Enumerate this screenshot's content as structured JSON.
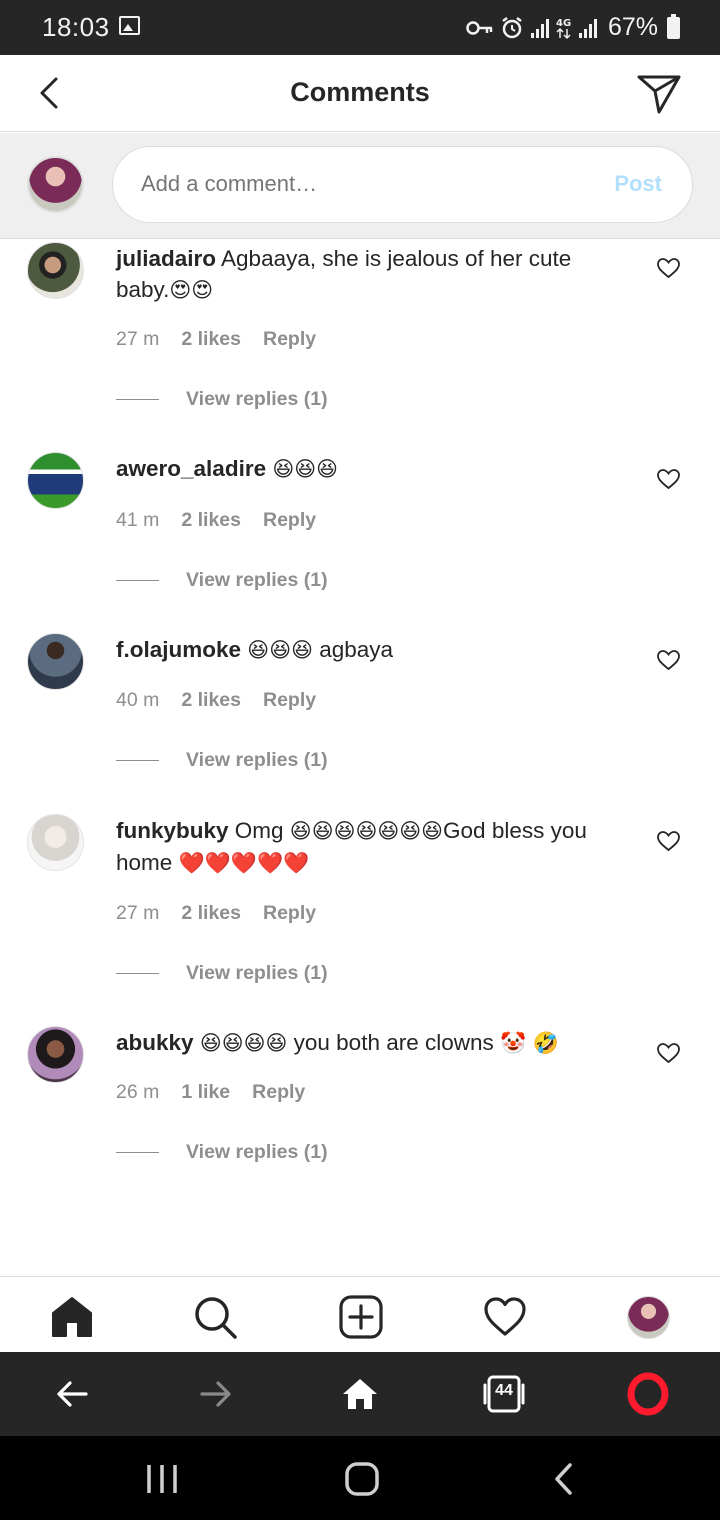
{
  "status_bar": {
    "time": "18:03",
    "battery_percent": "67%",
    "network_type": "4G",
    "icons": [
      "image-icon",
      "key-icon",
      "alarm-icon",
      "signal-icon",
      "signal-icon",
      "battery-icon"
    ]
  },
  "header": {
    "title": "Comments",
    "back_icon": "chevron-left-icon",
    "send_icon": "paper-plane-icon"
  },
  "composer": {
    "placeholder": "Add a comment…",
    "post_label": "Post"
  },
  "comments": [
    {
      "username": "juliadairo",
      "text": " Agbaaya, she is jealous of her cute baby.",
      "emoji": "😍😍",
      "time": "27 m",
      "likes": "2 likes",
      "reply_label": "Reply",
      "view_replies": "View replies (1)"
    },
    {
      "username": "awero_aladire",
      "text": " ",
      "emoji": "😆😆😆",
      "time": "41 m",
      "likes": "2 likes",
      "reply_label": "Reply",
      "view_replies": "View replies (1)"
    },
    {
      "username": "f.olajumoke",
      "text": " ",
      "emoji": "😆😆😆",
      "text_after": " agbaya",
      "time": "40 m",
      "likes": "2 likes",
      "reply_label": "Reply",
      "view_replies": "View replies (1)"
    },
    {
      "username": "funkybuky",
      "text": " Omg ",
      "emoji": "😆😆😆😆😆😆😆",
      "text_after": "God bless you home ",
      "emoji_after": "❤️❤️❤️❤️❤️",
      "time": "27 m",
      "likes": "2 likes",
      "reply_label": "Reply",
      "view_replies": "View replies (1)"
    },
    {
      "username": "abukky",
      "text": " ",
      "emoji": "😆😆😆😆",
      "text_after": " you both are clowns ",
      "emoji_after": "🤡 🤣",
      "time": "26 m",
      "likes": "1 like",
      "reply_label": "Reply",
      "view_replies": "View replies (1)"
    }
  ],
  "tabbar": {
    "items": [
      "home-icon",
      "search-icon",
      "add-post-icon",
      "heart-icon",
      "profile-avatar"
    ]
  },
  "browser_bar": {
    "tab_count": "44",
    "items": [
      "back-arrow-icon",
      "forward-arrow-icon",
      "home-icon",
      "tabs-icon",
      "opera-logo-icon"
    ]
  },
  "colors": {
    "status_bar_bg": "#262626",
    "link_blue_disabled": "#b2dffc",
    "meta_gray": "#8e8e8e",
    "heart_red": "#e0245e",
    "opera_red": "#ff1b2d"
  }
}
